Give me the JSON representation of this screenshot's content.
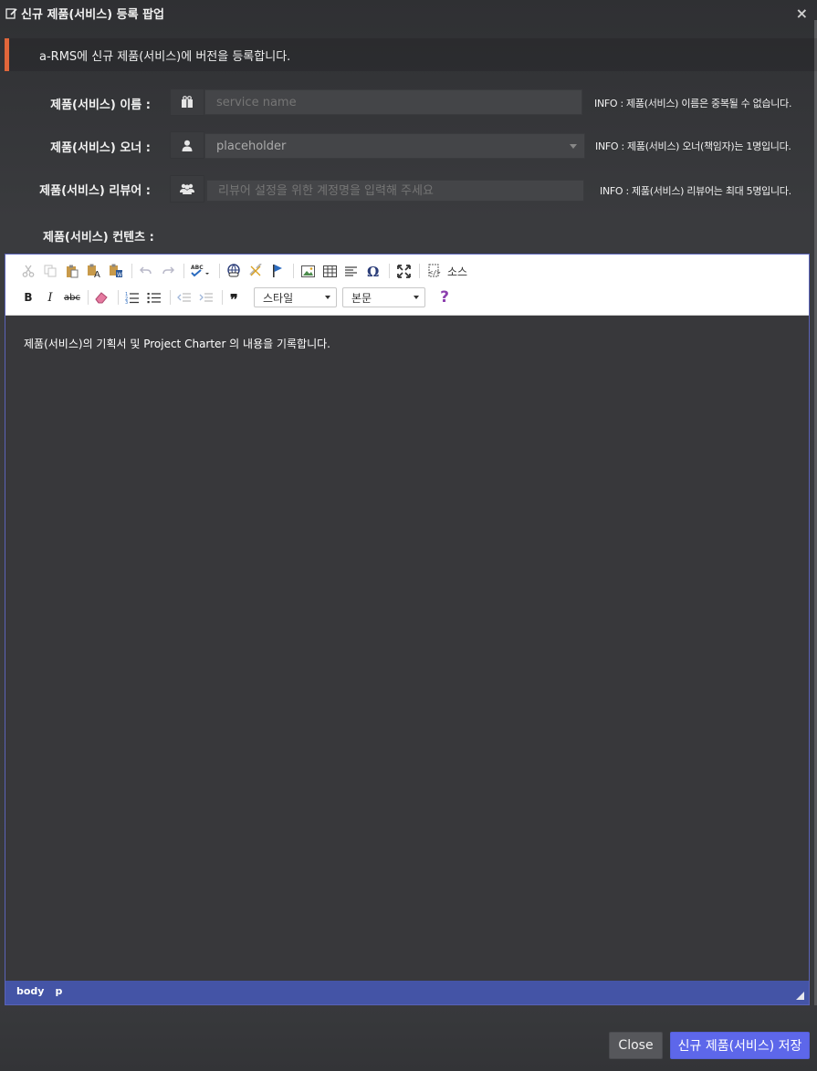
{
  "window": {
    "title": "신규 제품(서비스) 등록 팝업",
    "close_label": "×"
  },
  "notice": {
    "text": "a-RMS에 신규 제품(서비스)에 버전을 등록합니다."
  },
  "form": {
    "name": {
      "label": "제품(서비스) 이름 :",
      "placeholder": "service name",
      "info": "INFO : 제품(서비스) 이름은 중복될 수 없습니다."
    },
    "owner": {
      "label": "제품(서비스) 오너 :",
      "value": "placeholder",
      "info": "INFO : 제품(서비스) 오너(책임자)는 1명입니다."
    },
    "reviewer": {
      "label": "제품(서비스) 리뷰어 :",
      "placeholder": "리뷰어 설정을 위한 계정명을 입력해 주세요",
      "info": "INFO : 제품(서비스) 리뷰어는 최대 5명입니다."
    },
    "content": {
      "label": "제품(서비스) 컨텐츠 :"
    }
  },
  "editor": {
    "source_label": "소스",
    "bold_label": "B",
    "italic_label": "I",
    "strike_label": "abc",
    "style_combo": "스타일",
    "format_combo": "본문",
    "help_label": "?",
    "content_text": "제품(서비스)의 기획서 및 Project Charter 의 내용을 기록합니다.",
    "path": [
      "body",
      "p"
    ]
  },
  "buttons": {
    "close": "Close",
    "save": "신규 제품(서비스) 저장"
  },
  "colors": {
    "accent": "#e0663b",
    "primary": "#5d67ea",
    "status_bar": "#4454a6"
  }
}
